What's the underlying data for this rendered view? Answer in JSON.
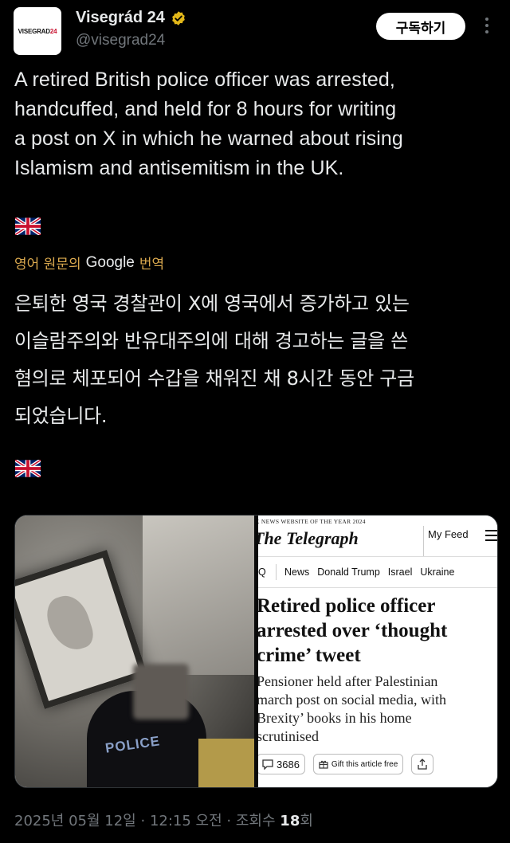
{
  "author": {
    "avatar_text_black": "VISEGRAD",
    "avatar_text_red": "24",
    "name": "Visegrád 24",
    "handle": "@visegrad24",
    "subscribe_label": "구독하기"
  },
  "tweet": {
    "text": "A retired British police officer was arrested,\nhandcuffed, and held for 8 hours for writing\na post on X in which he warned about rising\nIslamism and antisemitism in the UK.",
    "flag_emoji": "uk-flag-icon"
  },
  "translation": {
    "prefix": "영어 원문의",
    "google": "Google",
    "suffix": "번역",
    "text": "은퇴한 영국 경찰관이 X에 영국에서 증가하고 있는\n이슬람주의와 반유대주의에 대해 경고하는 글을 쓴\n혐의로 체포되어 수갑을 채워진 채 8시간 동안 구금\n되었습니다."
  },
  "media": {
    "photo_label": "POLICE",
    "article": {
      "award": "K NEWS WEBSITE OF THE YEAR 2024",
      "masthead": "The Telegraph",
      "my_feed": "My Feed",
      "nav": [
        "News",
        "Donald Trump",
        "Israel",
        "Ukraine"
      ],
      "search_stub": "Q",
      "headline": "Retired police officer\narrested over ‘thought\ncrime’ tweet",
      "standfirst": "Pensioner held after Palestinian\nmarch post on social media, with\nBrexity’ books in his home\nscrutinised",
      "comments": "3686",
      "gift": "Gift this article free"
    }
  },
  "footer": {
    "date": "2025년 05월 12일",
    "time": "12:15 오전",
    "views_label": "조회수",
    "views": "18",
    "views_suffix": "회",
    "sep": "·"
  },
  "colors": {
    "background": "#000000",
    "verified": "#e2b719",
    "translate_accent": "#d9a84e",
    "muted": "#71767b"
  }
}
